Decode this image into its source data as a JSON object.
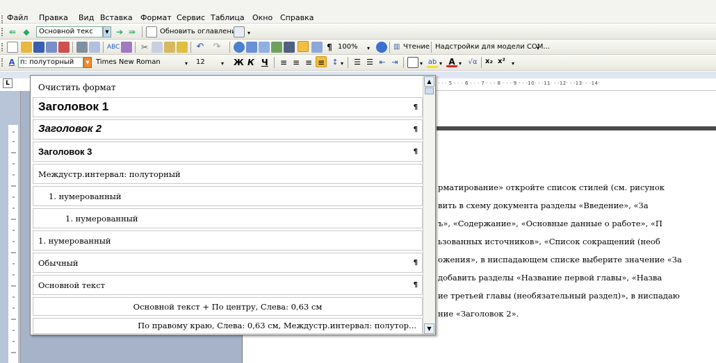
{
  "menubar": {
    "items": [
      "Файл",
      "Правка",
      "Вид",
      "Вставка",
      "Формат",
      "Сервис",
      "Таблица",
      "Окно",
      "Справка"
    ]
  },
  "toolbar_nav": {
    "style_box": "Основной текс",
    "update_toc": "Обновить оглавление"
  },
  "toolbar_std": {
    "zoom": "100%",
    "reading": "Чтение",
    "addins": "Надстройки для модели COM..."
  },
  "toolbar_fmt": {
    "style_value": "п: полуторный",
    "font_value": "Times New Roman",
    "size_value": "12",
    "bold": "Ж",
    "italic": "К",
    "underline": "Ч",
    "sub": "x₂",
    "sup": "x²"
  },
  "ruler": {
    "corner": "L",
    "ticks": "· · · 5 · · · 6 · · · 7 · · · 8 · · · 9 · · ·10· · ·11· · ·12· · ·13· · ·14·"
  },
  "style_list": [
    {
      "label": "Очистить формат"
    },
    {
      "label": "Заголовок 1",
      "pilcrow": "¶"
    },
    {
      "label": "Заголовок 2",
      "pilcrow": "¶"
    },
    {
      "label": "Заголовок 3",
      "pilcrow": "¶"
    },
    {
      "label": "Междустр.интервал: полуторный"
    },
    {
      "label": "1. нумерованный"
    },
    {
      "label": "1. нумерованный"
    },
    {
      "label": "1. нумерованный"
    },
    {
      "label": "Обычный",
      "pilcrow": "¶"
    },
    {
      "label": "Основной текст",
      "pilcrow": "¶"
    },
    {
      "label": "Основной текст + По центру, Слева: 0,63 см"
    },
    {
      "label": "По правому краю, Слева: 0,63 см, Междустр.интервал: полутор..."
    }
  ],
  "document": {
    "lines": [
      "рматирование» откройте список стилей (см. рисунок",
      "вить в схему документа разделы «Введение», «За",
      "ъ», «Содержание», «Основные данные о работе», «П",
      "ьзованных источников», «Список сокращений (необ",
      "ожения», в ниспадающем списке выберите значение «За",
      "добавить разделы «Название первой главы», «Назва",
      "ие третьей главы (необязательный раздел)», в ниспадаю",
      "ние «Заголовок 2»."
    ]
  }
}
